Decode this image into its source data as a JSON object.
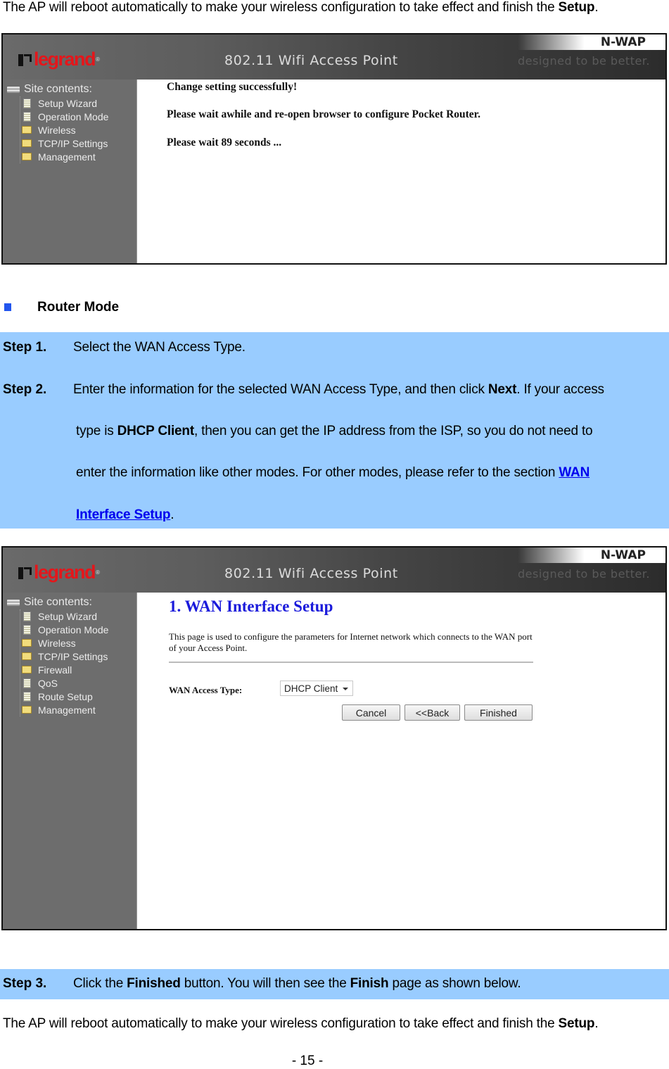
{
  "intro": {
    "text_before": "The AP will reboot automatically to make your wireless configuration to take effect and finish the ",
    "bold": "Setup",
    "text_after": "."
  },
  "router_ui": {
    "brand": "legrand",
    "title": "802.11 Wifi Access Point",
    "product": "N-WAP",
    "tagline": "designed to be better.",
    "nav_heading": "Site contents:"
  },
  "screenshot1": {
    "nav_items": [
      {
        "label": "Setup Wizard",
        "icon": "document"
      },
      {
        "label": "Operation Mode",
        "icon": "document"
      },
      {
        "label": "Wireless",
        "icon": "folder"
      },
      {
        "label": "TCP/IP Settings",
        "icon": "folder"
      },
      {
        "label": "Management",
        "icon": "folder"
      }
    ],
    "messages": [
      "Change setting successfully!",
      "Please wait awhile and re-open browser to configure Pocket Router.",
      "Please wait 89 seconds ..."
    ]
  },
  "section": {
    "title": "Router Mode",
    "bullet_color": "#2255ee"
  },
  "steps_block": {
    "background": "#99ccff",
    "step1": {
      "label": "Step 1.",
      "text": "Select the WAN Access Type."
    },
    "step2": {
      "label": "Step 2.",
      "line1_a": "Enter the information for the selected WAN Access Type, and then click ",
      "line1_bold": "Next",
      "line1_b": ". If your access",
      "line2_a": "type is ",
      "line2_bold": "DHCP Client",
      "line2_b": ", then you can get the IP address from the ISP, so you do not need to",
      "line3_a": "enter the information like other modes. For other modes, please refer to the section ",
      "link_part1": "WAN ",
      "link_part2": "Interface Setup",
      "line4_b": "."
    }
  },
  "screenshot2": {
    "nav_items": [
      {
        "label": "Setup Wizard",
        "icon": "document"
      },
      {
        "label": "Operation Mode",
        "icon": "document"
      },
      {
        "label": "Wireless",
        "icon": "folder"
      },
      {
        "label": "TCP/IP Settings",
        "icon": "folder"
      },
      {
        "label": "Firewall",
        "icon": "folder"
      },
      {
        "label": "QoS",
        "icon": "document"
      },
      {
        "label": "Route Setup",
        "icon": "document"
      },
      {
        "label": "Management",
        "icon": "folder"
      }
    ],
    "heading": "1. WAN Interface Setup",
    "description": "This page is used to configure the parameters for Internet network which connects to the WAN port of your Access Point.",
    "wan_access_type_label": "WAN Access Type:",
    "wan_access_type_value": "DHCP Client",
    "buttons": {
      "cancel": "Cancel",
      "back": "<<Back",
      "finished": "Finished"
    }
  },
  "step3": {
    "label": "Step 3.",
    "text_a": "Click the ",
    "bold1": "Finished",
    "text_b": " button. You will then see the ",
    "bold2": "Finish",
    "text_c": " page as shown below."
  },
  "outro": {
    "text_before": "The AP will reboot automatically to make your wireless configuration to take effect and finish the ",
    "bold": "Setup",
    "text_after": "."
  },
  "page_number": "- 15 -"
}
